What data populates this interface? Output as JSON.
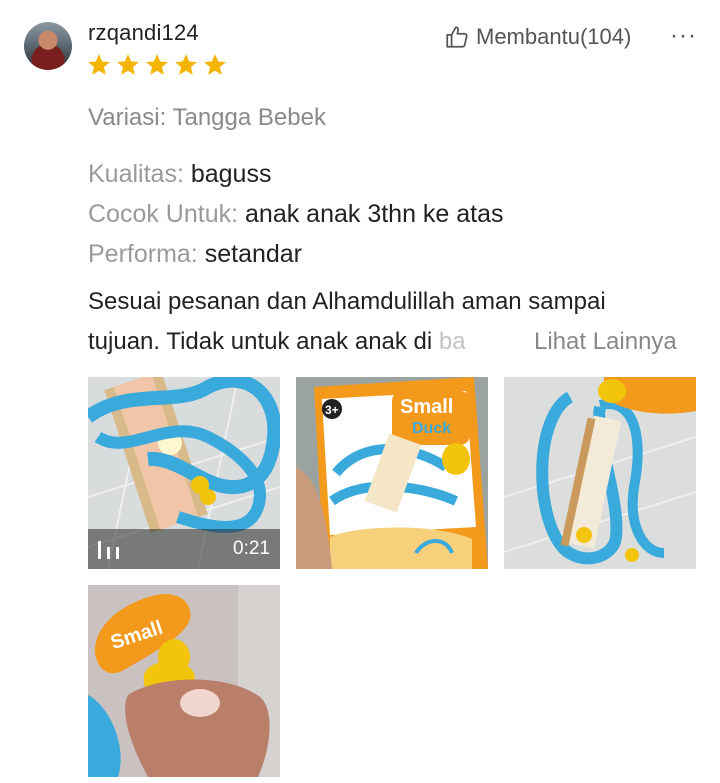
{
  "review": {
    "username": "rzqandi124",
    "rating": 5,
    "helpful_label": "Membantu(104)",
    "more_label": "···",
    "variant": "Variasi: Tangga Bebek",
    "attributes": [
      {
        "key": "Kualitas:",
        "value": "baguss"
      },
      {
        "key": "Cocok Untuk:",
        "value": "anak anak 3thn ke atas"
      },
      {
        "key": "Performa:",
        "value": "setandar"
      }
    ],
    "body_line1": "Sesuai pesanan dan Alhamdulillah aman sampai",
    "body_line2_main": "tujuan. Tidak untuk anak anak di ",
    "body_line2_faded": "ba",
    "see_more": "Lihat Lainnya",
    "media": {
      "video_duration": "0:21",
      "box_text_top": "Small",
      "box_text_bottom": "Duck",
      "age_badge": "3+",
      "card_text": "Small"
    }
  },
  "colors": {
    "star": "#f5b400",
    "track_blue": "#3aa9dc",
    "duck_yellow": "#f2c40c",
    "box_orange": "#f39a1c"
  }
}
